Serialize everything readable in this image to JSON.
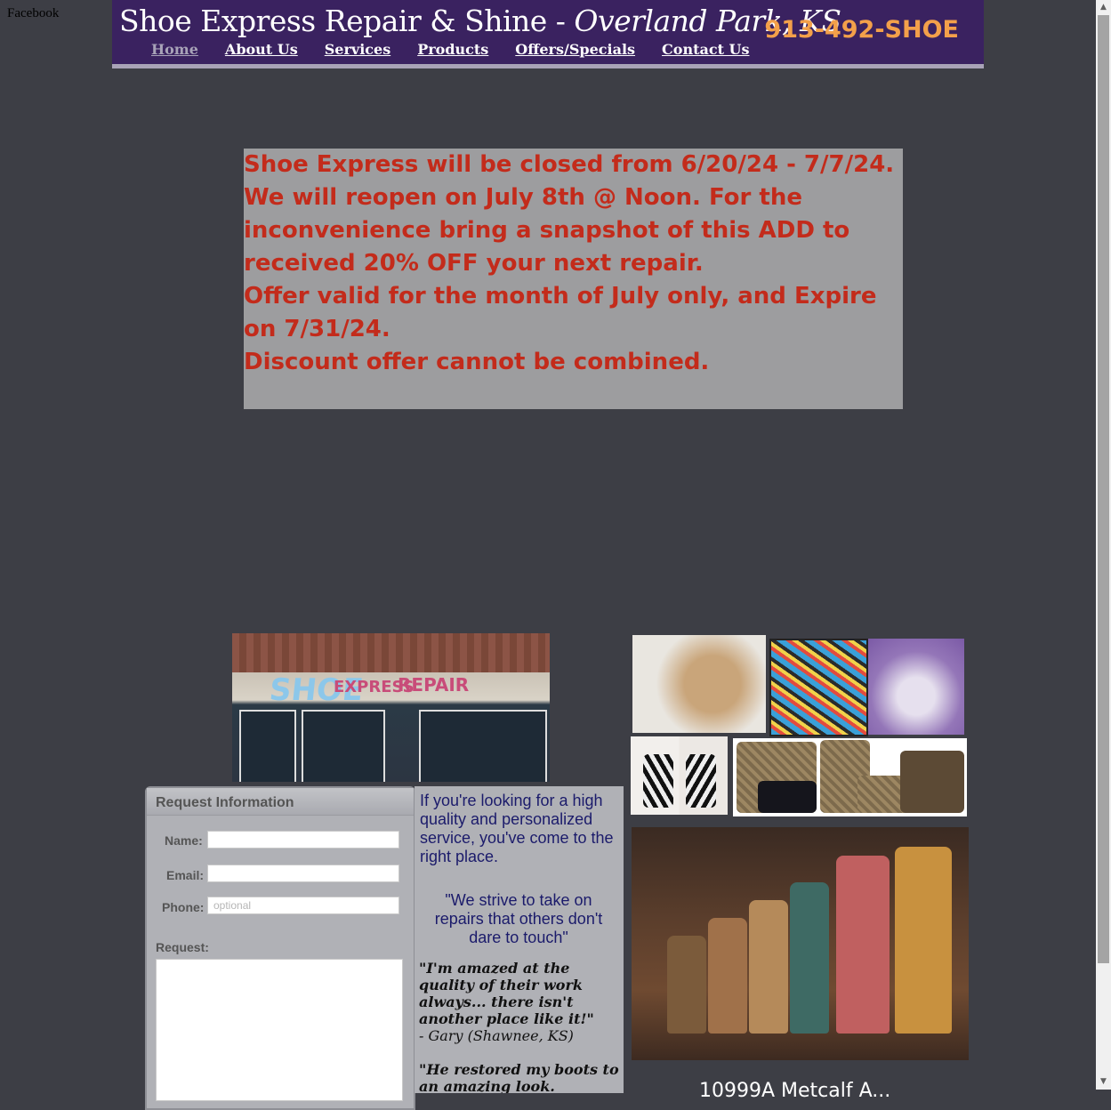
{
  "facebook": {
    "label": "Facebook"
  },
  "header": {
    "title_main": "Shoe Express Repair & Shine - ",
    "title_location": "Overland Park, KS",
    "phone": "913-492-SHOE",
    "nav": [
      {
        "label": "Home",
        "active": true
      },
      {
        "label": "About Us"
      },
      {
        "label": "Services"
      },
      {
        "label": "Products"
      },
      {
        "label": "Offers/Specials"
      },
      {
        "label": "Contact Us"
      }
    ]
  },
  "notice": {
    "lines": [
      "Shoe Express will be closed from 6/20/24 - 7/7/24.",
      "We will reopen on July 8th @ Noon. For the inconvenience bring a snapshot of this ADD to received 20% OFF your next repair.",
      "Offer valid for the month of July only, and Expire on 7/31/24.",
      "Discount offer cannot be combined."
    ],
    "color": "#c32b1b"
  },
  "storefront": {
    "sign_shoe": "SHOE",
    "sign_express": "EXPRESS",
    "sign_repair": "REPAIR"
  },
  "form": {
    "title": "Request Information",
    "name_label": "Name:",
    "email_label": "Email:",
    "phone_label": "Phone:",
    "phone_placeholder": "optional",
    "request_label": "Request:"
  },
  "testimonials": {
    "intro": "If you're looking for a high quality and personalized service, you've come to the right place.",
    "motto": "\"We strive to take on repairs that others don't dare to touch\"",
    "reviews": [
      {
        "text": "\"I'm amazed at the quality of their work always... there isn't another place like it!\"",
        "author": "- Gary (Shawnee, KS)"
      },
      {
        "text": "\"He restored my boots to an amazing look. Forever",
        "author": ""
      }
    ]
  },
  "address": {
    "partial": "10999A Metcalf A..."
  },
  "colors": {
    "page_bg": "#3d3e45",
    "header_bg": "#3a2260",
    "phone": "#f3a04a",
    "text_blue": "#1b1b6b"
  }
}
